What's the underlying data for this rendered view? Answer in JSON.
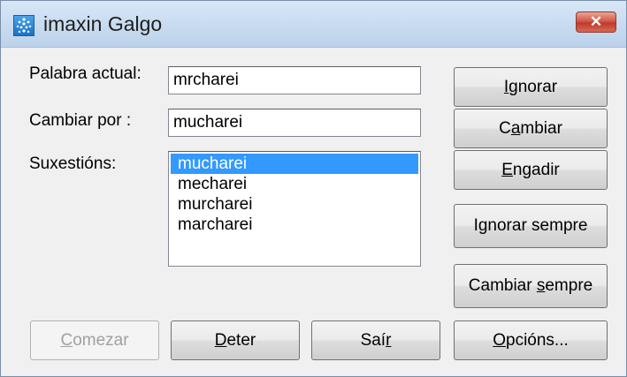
{
  "window": {
    "title": "imaxin Galgo",
    "close_glyph": "✕"
  },
  "fields": {
    "current_word_label": "Palabra actual:",
    "current_word_value": "mrcharei",
    "replace_label": "Cambiar por :",
    "replace_value": "mucharei",
    "suggestions_label": "Suxestións:"
  },
  "suggestions": {
    "items": [
      "mucharei",
      "mecharei",
      "murcharei",
      "marcharei"
    ],
    "selected_index": 0,
    "selected_color": "#3399ff"
  },
  "buttons": {
    "ignore": {
      "pre": "",
      "key": "I",
      "post": "gnorar"
    },
    "change": {
      "pre": "C",
      "key": "a",
      "post": "mbiar"
    },
    "add": {
      "pre": "",
      "key": "E",
      "post": "ngadir"
    },
    "ignore_all": {
      "pre": "I",
      "key": "g",
      "post": "norar sempre"
    },
    "change_all": {
      "pre": "Cambiar ",
      "key": "s",
      "post": "empre"
    },
    "start": {
      "pre": "",
      "key": "C",
      "post": "omezar",
      "enabled": false
    },
    "stop": {
      "pre": "",
      "key": "D",
      "post": "eter"
    },
    "exit": {
      "pre": "Saí",
      "key": "r",
      "post": ""
    },
    "options": {
      "pre": "",
      "key": "O",
      "post": "pcións..."
    }
  },
  "colors": {
    "titlebar": "#c9dcf0",
    "close_button": "#c2392b",
    "dialog_background": "#f0f0f0"
  },
  "icons": {
    "app": "galgo-app-icon",
    "close": "close-icon"
  }
}
